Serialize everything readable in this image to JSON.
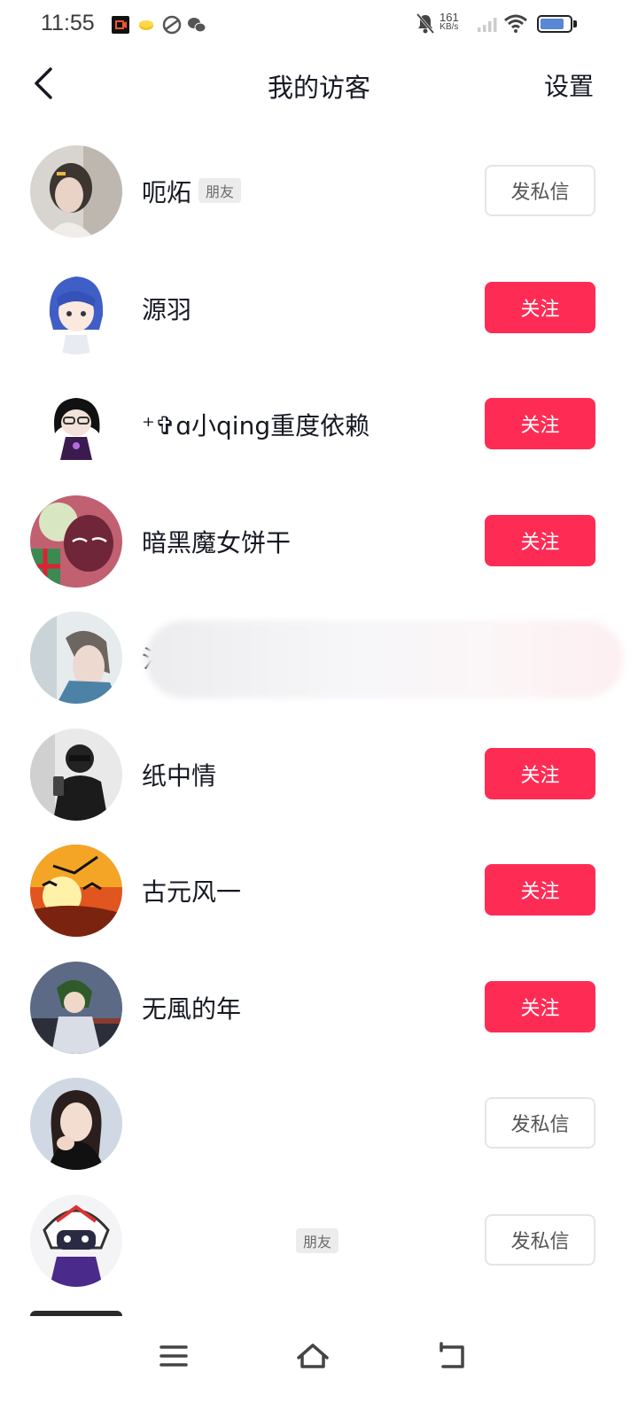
{
  "status_bar": {
    "time": "11:55",
    "net_speed_value": "161",
    "net_speed_unit": "KB/s",
    "battery_level": 0.8
  },
  "header": {
    "title": "我的访客",
    "settings_label": "设置",
    "back_icon": "chevron-left-icon"
  },
  "visitors": [
    {
      "name": "呃炻",
      "tag": "朋友",
      "action": "发私信",
      "action_type": "message"
    },
    {
      "name": "源羽",
      "tag": "",
      "action": "关注",
      "action_type": "follow"
    },
    {
      "name": "⁺✞ɑ小qing重度依赖",
      "tag": "",
      "action": "关注",
      "action_type": "follow"
    },
    {
      "name": "暗黑魔女饼干",
      "tag": "",
      "action": "关注",
      "action_type": "follow"
    },
    {
      "name": "氵",
      "tag": "",
      "action": "",
      "action_type": "hidden"
    },
    {
      "name": "纸中情",
      "tag": "",
      "action": "关注",
      "action_type": "follow"
    },
    {
      "name": "古元风一",
      "tag": "",
      "action": "关注",
      "action_type": "follow"
    },
    {
      "name": "无風的年",
      "tag": "",
      "action": "关注",
      "action_type": "follow"
    },
    {
      "name": "",
      "tag": "",
      "action": "发私信",
      "action_type": "message"
    },
    {
      "name": "",
      "tag": "朋友",
      "action": "发私信",
      "action_type": "message"
    }
  ],
  "nav_bar": {
    "menu_icon": "menu-icon",
    "home_icon": "home-icon",
    "back_icon": "back-icon"
  },
  "colors": {
    "follow": "#fe2c55",
    "text": "#161823"
  }
}
